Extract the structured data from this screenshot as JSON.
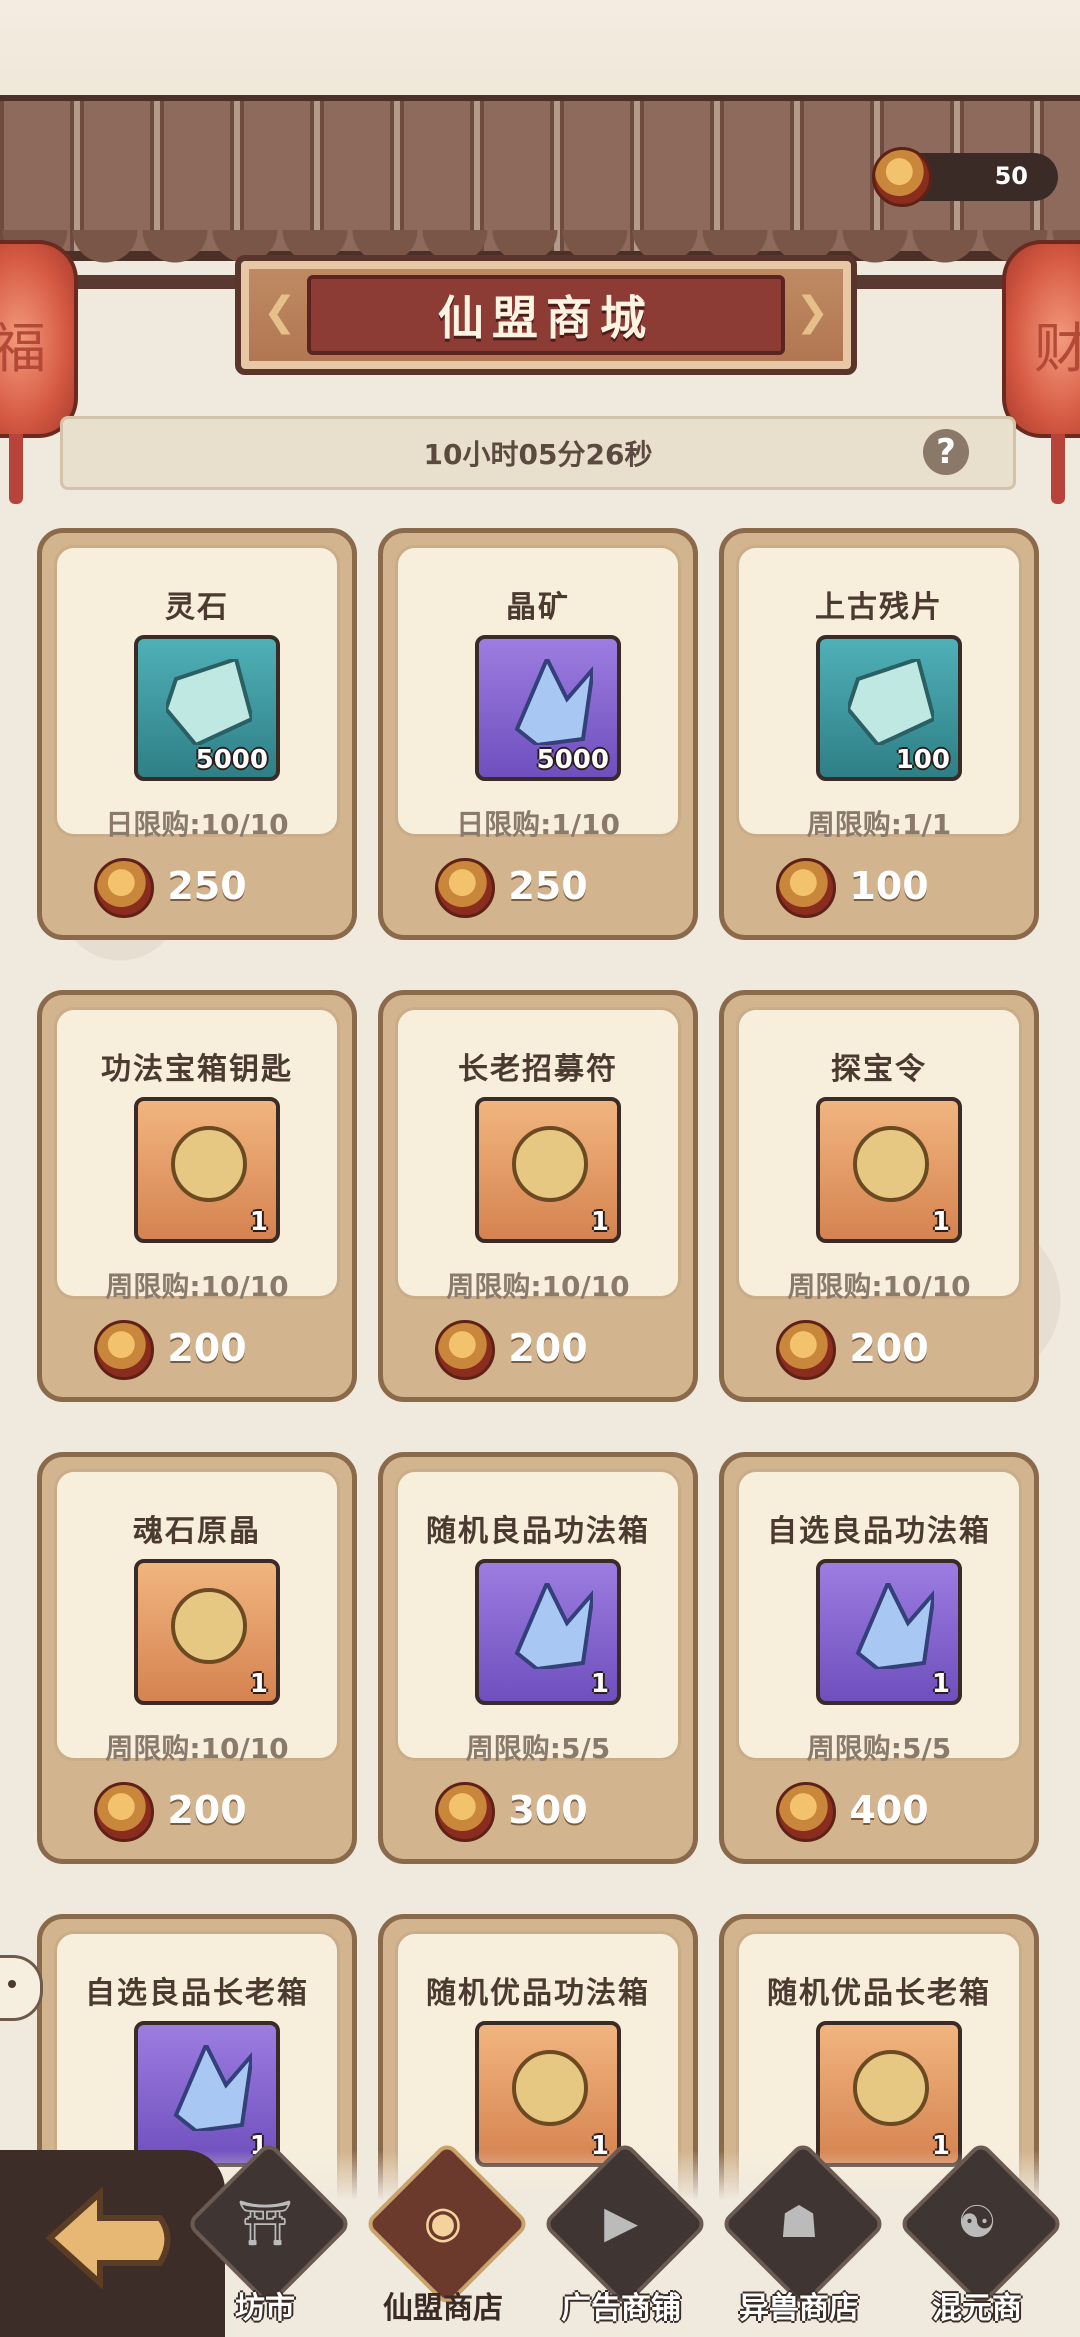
{
  "header": {
    "title": "仙盟商城",
    "currency_amount": "50",
    "timer": "10小时05分26秒",
    "help_label": "?",
    "lantern_left_char": "福",
    "lantern_right_char": "财"
  },
  "items": [
    {
      "name": "灵石",
      "qty": "5000",
      "limit": "日限购:10/10",
      "price": "250",
      "icon": "spirit-stone-icon",
      "bg": "teal"
    },
    {
      "name": "晶矿",
      "qty": "5000",
      "limit": "日限购:1/10",
      "price": "250",
      "icon": "crystal-ore-icon",
      "bg": "purple"
    },
    {
      "name": "上古残片",
      "qty": "100",
      "limit": "周限购:1/1",
      "price": "100",
      "icon": "ancient-fragment-icon",
      "bg": "teal"
    },
    {
      "name": "功法宝箱钥匙",
      "qty": "1",
      "limit": "周限购:10/10",
      "price": "200",
      "icon": "chest-key-icon",
      "bg": "orange"
    },
    {
      "name": "长老招募符",
      "qty": "1",
      "limit": "周限购:10/10",
      "price": "200",
      "icon": "recruit-talisman-icon",
      "bg": "orange"
    },
    {
      "name": "探宝令",
      "qty": "1",
      "limit": "周限购:10/10",
      "price": "200",
      "icon": "treasure-token-icon",
      "bg": "orange"
    },
    {
      "name": "魂石原晶",
      "qty": "1",
      "limit": "周限购:10/10",
      "price": "200",
      "icon": "soul-crystal-icon",
      "bg": "orange"
    },
    {
      "name": "随机良品功法箱",
      "qty": "1",
      "limit": "周限购:5/5",
      "price": "300",
      "icon": "random-chest-icon",
      "bg": "purple"
    },
    {
      "name": "自选良品功法箱",
      "qty": "1",
      "limit": "周限购:5/5",
      "price": "400",
      "icon": "select-chest-icon",
      "bg": "purple"
    },
    {
      "name": "自选良品长老箱",
      "qty": "1",
      "limit": "",
      "price": "",
      "icon": "elder-chest-icon",
      "bg": "purple"
    },
    {
      "name": "随机优品功法箱",
      "qty": "1",
      "limit": "",
      "price": "",
      "icon": "random-chest-icon",
      "bg": "orange"
    },
    {
      "name": "随机优品长老箱",
      "qty": "1",
      "limit": "",
      "price": "",
      "icon": "random-elder-chest-icon",
      "bg": "orange"
    }
  ],
  "nav": [
    {
      "label": "坊市",
      "icon": "market-icon",
      "glyph": "⛩"
    },
    {
      "label": "仙盟商店",
      "icon": "guild-shop-icon",
      "glyph": "◉",
      "active": true
    },
    {
      "label": "广告商铺",
      "icon": "ad-shop-icon",
      "glyph": "▶"
    },
    {
      "label": "异兽商店",
      "icon": "beast-shop-icon",
      "glyph": "☗"
    },
    {
      "label": "混元商",
      "icon": "hunyuan-shop-icon",
      "glyph": "☯"
    }
  ],
  "colors": {
    "accent": "#8d3b35",
    "card_bg": "#d2b48e",
    "card_inner": "#f7efdc"
  }
}
